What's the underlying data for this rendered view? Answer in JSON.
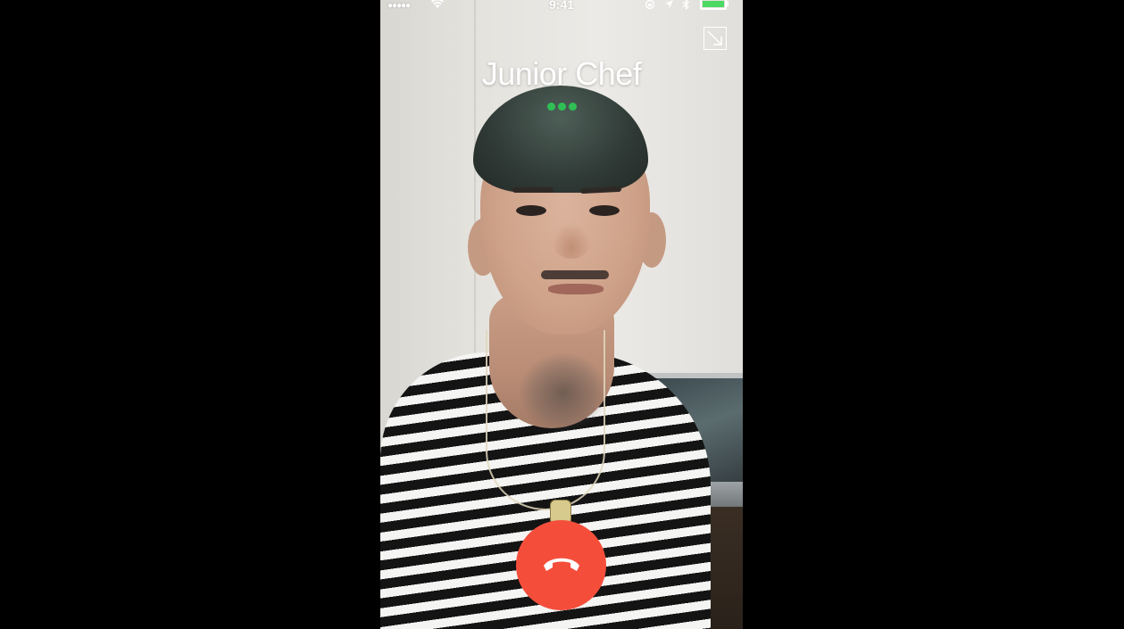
{
  "status_bar": {
    "signal_icon": "signal-dots-icon",
    "wifi_icon": "wifi-icon",
    "time": "9:41",
    "rotation_lock_icon": "rotation-lock-icon",
    "location_icon": "location-arrow-icon",
    "bluetooth_icon": "bluetooth-icon",
    "battery_icon": "battery-icon",
    "battery_level": 1.0
  },
  "call": {
    "contact_name": "Junior Chef",
    "status_dots": 3,
    "minimize_icon": "minimize-arrow-icon",
    "end_call_icon": "phone-hangup-icon"
  },
  "colors": {
    "end_call": "#f44e3b",
    "status_dots": "#2fbf54",
    "battery": "#4cd964",
    "background": "#000000"
  }
}
